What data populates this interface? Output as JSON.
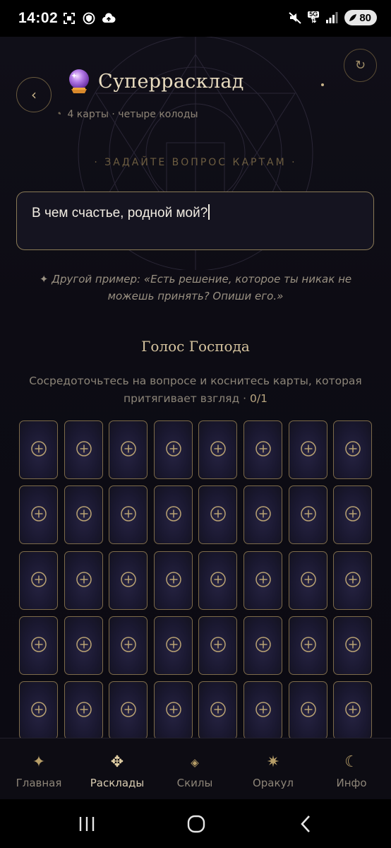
{
  "status_bar": {
    "time": "14:02",
    "network": "5G",
    "battery": "80",
    "icons": [
      "screenshot-icon",
      "shield-icon",
      "cloud-upload-icon",
      "mute-icon",
      "signal-icon",
      "battery-icon"
    ]
  },
  "header": {
    "back_icon": "‹",
    "refresh_icon": "↻",
    "title": "Суперрасклад",
    "subtitle": "4 карты · четыре колоды"
  },
  "question": {
    "label": "· ЗАДАЙТЕ ВОПРОС КАРТАМ ·",
    "value": "В чем счастье, родной мой?",
    "example": "✦ Другой пример: «Есть решение, которое ты никак не можешь принять? Опиши его.»"
  },
  "deck": {
    "title": "Голос Господа",
    "instruction": "Сосредоточьтесь на вопросе и коснитесь карты, которая притягивает взгляд · ",
    "count": "0/1",
    "columns": 8,
    "full_rows": 5,
    "partial_rows": 1
  },
  "nav": {
    "items": [
      {
        "label": "Главная",
        "icon": "✦"
      },
      {
        "label": "Расклады",
        "icon": "✥"
      },
      {
        "label": "Скилы",
        "icon": "◈"
      },
      {
        "label": "Оракул",
        "icon": "✷"
      },
      {
        "label": "Инфо",
        "icon": "☾"
      }
    ],
    "active": 1
  },
  "colors": {
    "accent": "#c9b48a",
    "background": "#0c0b13",
    "card_border": "#7d6b4a",
    "card_fill": "#1a1830"
  }
}
